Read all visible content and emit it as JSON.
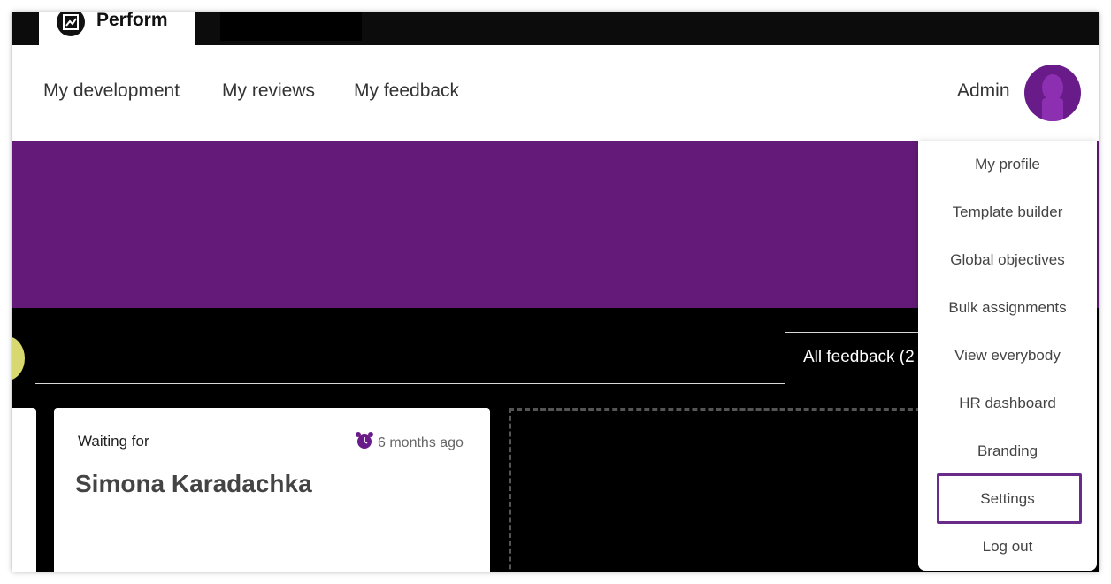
{
  "app": {
    "tab_label": "Perform"
  },
  "nav": {
    "links": [
      "My development",
      "My reviews",
      "My feedback"
    ],
    "user_label": "Admin"
  },
  "tabs": {
    "all_feedback": "All feedback (2"
  },
  "card": {
    "status": "Waiting for",
    "time": "6 months ago",
    "name": "Simona Karadachka"
  },
  "dropdown": {
    "items": [
      "My profile",
      "Template builder",
      "Global objectives",
      "Bulk assignments",
      "View everybody",
      "HR dashboard",
      "Branding",
      "Settings",
      "Log out"
    ],
    "highlighted": "Settings"
  },
  "colors": {
    "brand_purple": "#631a78",
    "avatar_purple": "#6a1b8a",
    "highlight_border": "#6a2a8a",
    "accent_yellow": "#d8d870"
  },
  "icons": {
    "app_logo": "chart-growth-icon",
    "avatar": "user-silhouette-icon",
    "time": "alarm-clock-icon"
  }
}
